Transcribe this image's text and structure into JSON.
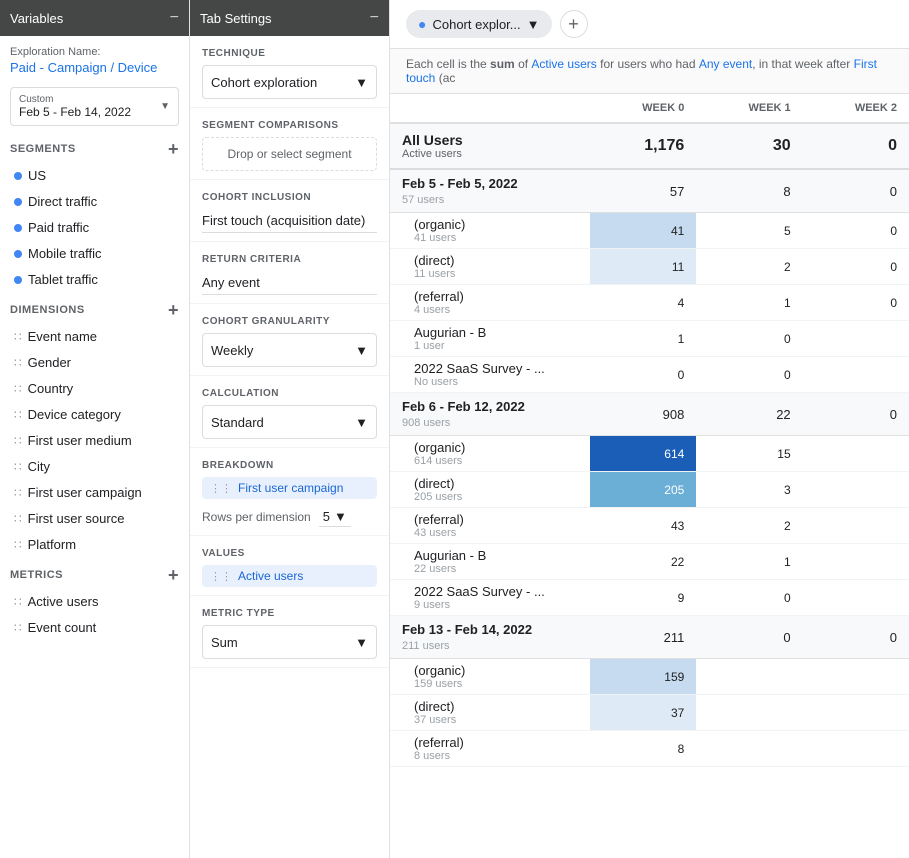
{
  "variablesPanel": {
    "title": "Variables",
    "explorationName": {
      "label": "Exploration Name:",
      "value": "Paid - Campaign / Device"
    },
    "dateRange": {
      "label": "Custom",
      "value": "Feb 5 - Feb 14, 2022"
    },
    "segments": {
      "title": "SEGMENTS",
      "items": [
        "US",
        "Direct traffic",
        "Paid traffic",
        "Mobile traffic",
        "Tablet traffic"
      ]
    },
    "dimensions": {
      "title": "DIMENSIONS",
      "items": [
        "Event name",
        "Gender",
        "Country",
        "Device category",
        "First user medium",
        "City",
        "First user campaign",
        "First user source",
        "Platform"
      ]
    },
    "metrics": {
      "title": "METRICS",
      "items": [
        "Active users",
        "Event count"
      ]
    }
  },
  "tabSettingsPanel": {
    "title": "Tab Settings",
    "technique": {
      "label": "TECHNIQUE",
      "value": "Cohort exploration"
    },
    "segmentComparisons": {
      "label": "SEGMENT COMPARISONS",
      "placeholder": "Drop or select segment"
    },
    "cohortInclusion": {
      "label": "COHORT INCLUSION",
      "value": "First touch (acquisition date)"
    },
    "returnCriteria": {
      "label": "RETURN CRITERIA",
      "value": "Any event"
    },
    "cohortGranularity": {
      "label": "COHORT GRANULARITY",
      "value": "Weekly"
    },
    "calculation": {
      "label": "CALCULATION",
      "value": "Standard"
    },
    "breakdown": {
      "label": "BREAKDOWN",
      "value": "First user campaign"
    },
    "rowsPerDimension": {
      "label": "Rows per dimension",
      "value": "5"
    },
    "values": {
      "label": "VALUES",
      "value": "Active users"
    },
    "metricType": {
      "label": "METRIC TYPE",
      "value": "Sum"
    }
  },
  "dataPanel": {
    "tabName": "Cohort explor...",
    "descriptionBar": "Each cell is the sum of Active users for users who had Any event, in that week after First touch (ac",
    "columns": [
      "WEEK 0",
      "WEEK 1",
      "WEEK 2"
    ],
    "allUsers": {
      "name": "All Users",
      "sub": "Active users",
      "values": [
        "1,176",
        "30",
        "0"
      ]
    },
    "groups": [
      {
        "label": "Feb 5 - Feb 5, 2022",
        "sublabel": "57 users",
        "values": [
          "57",
          "8",
          "0"
        ],
        "rows": [
          {
            "label": "(organic)",
            "sublabel": "41 users",
            "values": [
              "41",
              "5",
              "0"
            ],
            "heatmap": [
              "light",
              "none",
              "none"
            ]
          },
          {
            "label": "(direct)",
            "sublabel": "11 users",
            "values": [
              "11",
              "2",
              "0"
            ],
            "heatmap": [
              "lighter",
              "none",
              "none"
            ]
          },
          {
            "label": "(referral)",
            "sublabel": "4 users",
            "values": [
              "4",
              "1",
              "0"
            ],
            "heatmap": [
              "none",
              "none",
              "none"
            ]
          },
          {
            "label": "Augurian - B",
            "sublabel": "1 user",
            "values": [
              "1",
              "0",
              ""
            ],
            "heatmap": [
              "none",
              "none",
              "none"
            ]
          },
          {
            "label": "2022 SaaS Survey - ...",
            "sublabel": "No users",
            "values": [
              "0",
              "0",
              ""
            ],
            "heatmap": [
              "none",
              "none",
              "none"
            ]
          }
        ]
      },
      {
        "label": "Feb 6 - Feb 12, 2022",
        "sublabel": "908 users",
        "values": [
          "908",
          "22",
          "0"
        ],
        "rows": [
          {
            "label": "(organic)",
            "sublabel": "614 users",
            "values": [
              "614",
              "15",
              ""
            ],
            "heatmap": [
              "dark",
              "none",
              "none"
            ]
          },
          {
            "label": "(direct)",
            "sublabel": "205 users",
            "values": [
              "205",
              "3",
              ""
            ],
            "heatmap": [
              "medium",
              "none",
              "none"
            ]
          },
          {
            "label": "(referral)",
            "sublabel": "43 users",
            "values": [
              "43",
              "2",
              ""
            ],
            "heatmap": [
              "none",
              "none",
              "none"
            ]
          },
          {
            "label": "Augurian - B",
            "sublabel": "22 users",
            "values": [
              "22",
              "1",
              ""
            ],
            "heatmap": [
              "none",
              "none",
              "none"
            ]
          },
          {
            "label": "2022 SaaS Survey - ...",
            "sublabel": "9 users",
            "values": [
              "9",
              "0",
              ""
            ],
            "heatmap": [
              "none",
              "none",
              "none"
            ]
          }
        ]
      },
      {
        "label": "Feb 13 - Feb 14, 2022",
        "sublabel": "211 users",
        "values": [
          "211",
          "0",
          "0"
        ],
        "rows": [
          {
            "label": "(organic)",
            "sublabel": "159 users",
            "values": [
              "159",
              "",
              ""
            ],
            "heatmap": [
              "light",
              "none",
              "none"
            ]
          },
          {
            "label": "(direct)",
            "sublabel": "37 users",
            "values": [
              "37",
              "",
              ""
            ],
            "heatmap": [
              "lighter",
              "none",
              "none"
            ]
          },
          {
            "label": "(referral)",
            "sublabel": "8 users",
            "values": [
              "8",
              "",
              ""
            ],
            "heatmap": [
              "none",
              "none",
              "none"
            ]
          }
        ]
      }
    ]
  }
}
